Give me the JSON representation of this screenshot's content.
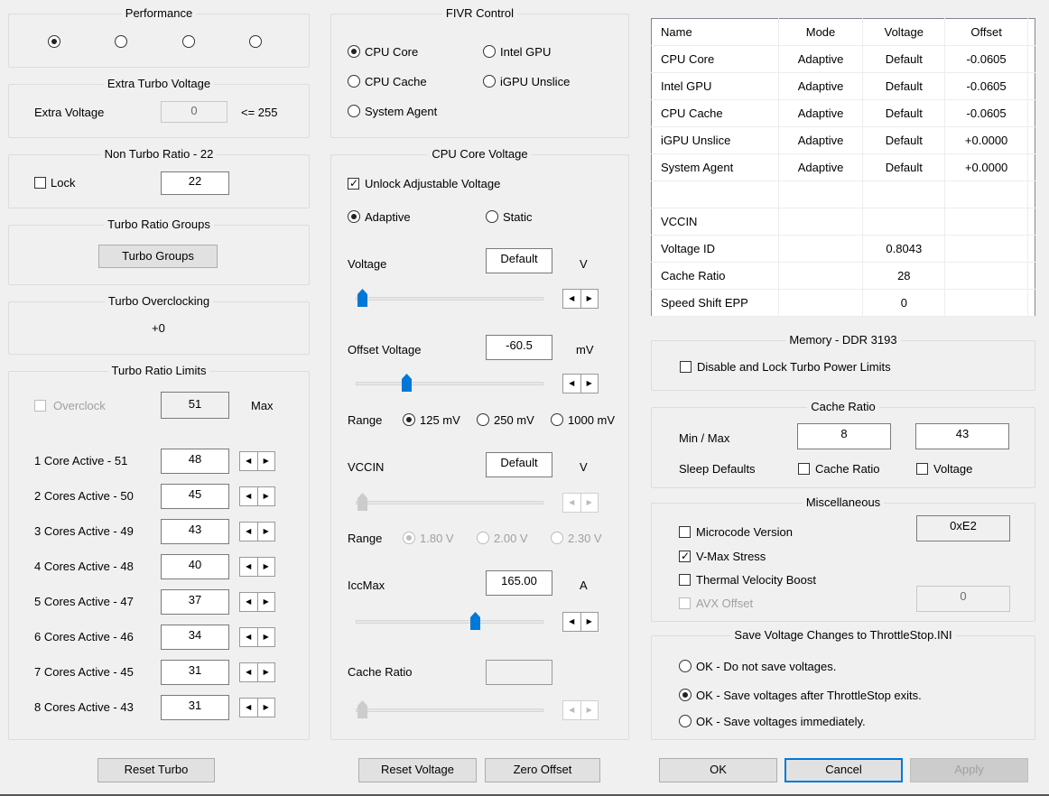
{
  "performance": {
    "title": "Performance",
    "selected": 0
  },
  "extra_turbo": {
    "title": "Extra Turbo Voltage",
    "label": "Extra Voltage",
    "value": "0",
    "limit": "<= 255"
  },
  "non_turbo": {
    "title": "Non Turbo Ratio - 22",
    "lock_label": "Lock",
    "value": "22"
  },
  "turbo_groups": {
    "title": "Turbo Ratio Groups",
    "button": "Turbo Groups"
  },
  "turbo_oc": {
    "title": "Turbo Overclocking",
    "value": "+0"
  },
  "turbo_limits": {
    "title": "Turbo Ratio Limits",
    "overclock_label": "Overclock",
    "overclock_value": "51",
    "max_label": "Max",
    "rows": [
      {
        "label": "1 Core  Active - 51",
        "value": "48"
      },
      {
        "label": "2 Cores Active - 50",
        "value": "45"
      },
      {
        "label": "3 Cores Active - 49",
        "value": "43"
      },
      {
        "label": "4 Cores Active - 48",
        "value": "40"
      },
      {
        "label": "5 Cores Active - 47",
        "value": "37"
      },
      {
        "label": "6 Cores Active - 46",
        "value": "34"
      },
      {
        "label": "7 Cores Active - 45",
        "value": "31"
      },
      {
        "label": "8 Cores Active - 43",
        "value": "31"
      }
    ]
  },
  "reset_turbo": "Reset Turbo",
  "fivr": {
    "title": "FIVR Control",
    "options": [
      "CPU Core",
      "Intel GPU",
      "CPU Cache",
      "iGPU Unslice",
      "System Agent"
    ],
    "selected": "CPU Core"
  },
  "core_voltage": {
    "title": "CPU Core Voltage",
    "unlock_label": "Unlock Adjustable Voltage",
    "adaptive_label": "Adaptive",
    "static_label": "Static",
    "voltage_label": "Voltage",
    "voltage_value": "Default",
    "voltage_unit": "V",
    "offset_label": "Offset Voltage",
    "offset_value": "-60.5",
    "offset_unit": "mV",
    "range_label": "Range",
    "offset_ranges": [
      "125 mV",
      "250 mV",
      "1000 mV"
    ],
    "vccin_label": "VCCIN",
    "vccin_value": "Default",
    "vccin_unit": "V",
    "vccin_ranges": [
      "1.80 V",
      "2.00 V",
      "2.30 V"
    ],
    "iccmax_label": "IccMax",
    "iccmax_value": "165.00",
    "iccmax_unit": "A",
    "cache_label": "Cache Ratio",
    "cache_value": ""
  },
  "reset_voltage": "Reset Voltage",
  "zero_offset": "Zero Offset",
  "table": {
    "headers": [
      "Name",
      "Mode",
      "Voltage",
      "Offset"
    ],
    "rows": [
      [
        "CPU Core",
        "Adaptive",
        "Default",
        "-0.0605"
      ],
      [
        "Intel GPU",
        "Adaptive",
        "Default",
        "-0.0605"
      ],
      [
        "CPU Cache",
        "Adaptive",
        "Default",
        "-0.0605"
      ],
      [
        "iGPU Unslice",
        "Adaptive",
        "Default",
        "+0.0000"
      ],
      [
        "System Agent",
        "Adaptive",
        "Default",
        "+0.0000"
      ],
      [
        "",
        "",
        "",
        ""
      ],
      [
        "VCCIN",
        "",
        "",
        ""
      ],
      [
        "Voltage ID",
        "",
        "0.8043",
        ""
      ],
      [
        "Cache Ratio",
        "",
        "28",
        ""
      ],
      [
        "Speed Shift EPP",
        "",
        "0",
        ""
      ]
    ]
  },
  "memory": {
    "title": "Memory - DDR 3193",
    "disable_label": "Disable and Lock Turbo Power Limits"
  },
  "cache_ratio": {
    "title": "Cache Ratio",
    "minmax_label": "Min / Max",
    "min": "8",
    "max": "43",
    "sleep_label": "Sleep Defaults",
    "cache_cb": "Cache Ratio",
    "voltage_cb": "Voltage"
  },
  "misc": {
    "title": "Miscellaneous",
    "microcode_label": "Microcode Version",
    "microcode_value": "0xE2",
    "vmax_label": "V-Max Stress",
    "tvb_label": "Thermal Velocity Boost",
    "avx_label": "AVX Offset",
    "avx_value": "0"
  },
  "save": {
    "title": "Save Voltage Changes to ThrottleStop.INI",
    "options": [
      "OK - Do not save voltages.",
      "OK - Save voltages after ThrottleStop exits.",
      "OK - Save voltages immediately."
    ],
    "selected": 1
  },
  "buttons": {
    "ok": "OK",
    "cancel": "Cancel",
    "apply": "Apply"
  }
}
